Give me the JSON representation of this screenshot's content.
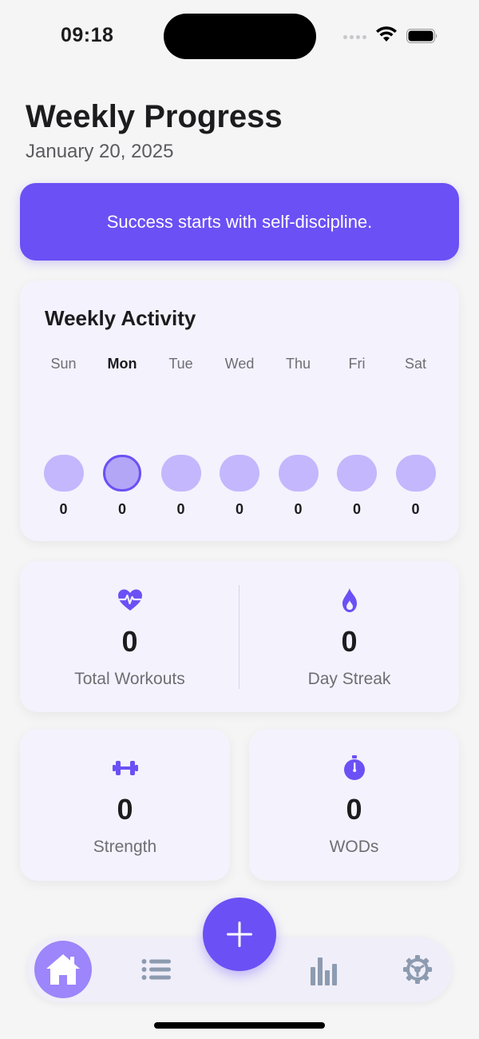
{
  "status_bar": {
    "time": "09:18"
  },
  "header": {
    "title": "Weekly Progress",
    "date": "January 20, 2025"
  },
  "quote": {
    "text": "Success starts with self-discipline."
  },
  "weekly_activity": {
    "title": "Weekly Activity",
    "days": [
      {
        "label": "Sun",
        "count": "0",
        "active": false
      },
      {
        "label": "Mon",
        "count": "0",
        "active": true
      },
      {
        "label": "Tue",
        "count": "0",
        "active": false
      },
      {
        "label": "Wed",
        "count": "0",
        "active": false
      },
      {
        "label": "Thu",
        "count": "0",
        "active": false
      },
      {
        "label": "Fri",
        "count": "0",
        "active": false
      },
      {
        "label": "Sat",
        "count": "0",
        "active": false
      }
    ]
  },
  "stats": {
    "total_workouts": {
      "value": "0",
      "label": "Total Workouts",
      "icon": "heart-pulse-icon"
    },
    "day_streak": {
      "value": "0",
      "label": "Day Streak",
      "icon": "flame-icon"
    },
    "strength": {
      "value": "0",
      "label": "Strength",
      "icon": "dumbbell-icon"
    },
    "wods": {
      "value": "0",
      "label": "WODs",
      "icon": "stopwatch-icon"
    }
  },
  "nav": {
    "items": [
      "home-icon",
      "list-icon",
      "add-icon",
      "chart-icon",
      "gear-icon"
    ],
    "active": "home"
  },
  "colors": {
    "accent": "#6b50f5",
    "card_bg": "#f4f2fd",
    "dot": "#c4b7fd",
    "nav_active_bg": "#9d85fb",
    "nav_inactive": "#8d9bb0"
  }
}
